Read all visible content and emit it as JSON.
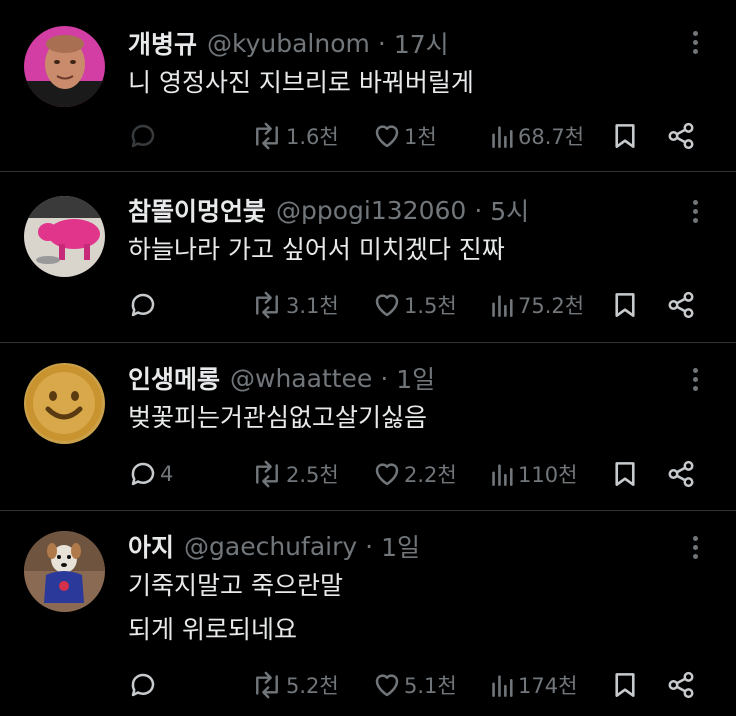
{
  "posts": [
    {
      "name": "개병규",
      "handle": "@kyubalnom",
      "time": "17시",
      "lines": [
        "니 영정사진 지브리로 바꿔버릴게"
      ],
      "avatar_icon": "person-portrait-avatar",
      "stats": {
        "replies": "",
        "reposts": "1.6천",
        "likes": "1천",
        "views": "68.7천"
      }
    },
    {
      "name": "참똘이멍언붗",
      "handle": "@ppogi132060",
      "time": "5시",
      "lines": [
        "하늘나라 가고 싶어서 미치겠다 진짜"
      ],
      "avatar_icon": "pink-pig-figure-avatar",
      "stats": {
        "replies": "",
        "reposts": "3.1천",
        "likes": "1.5천",
        "views": "75.2천"
      }
    },
    {
      "name": "인생메롱",
      "handle": "@whaattee",
      "time": "1일",
      "lines": [
        "벚꽃피는거관심없고살기싫음"
      ],
      "avatar_icon": "smiley-cookie-avatar",
      "stats": {
        "replies": "4",
        "reposts": "2.5천",
        "likes": "2.2천",
        "views": "110천"
      }
    },
    {
      "name": "아지",
      "handle": "@gaechufairy",
      "time": "1일",
      "lines": [
        "기죽지말고 죽으란말",
        "되게 위로되네요"
      ],
      "avatar_icon": "dog-in-sweater-avatar",
      "stats": {
        "replies": "",
        "reposts": "5.2천",
        "likes": "5.1천",
        "views": "174천"
      }
    }
  ],
  "separator": "·",
  "colors": {
    "background": "#000000",
    "text": "#e7e9ea",
    "muted": "#71767b",
    "divider": "#2f3336"
  }
}
